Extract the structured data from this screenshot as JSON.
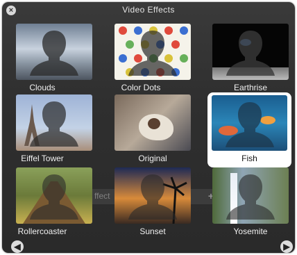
{
  "window": {
    "title": "Video Effects"
  },
  "background": {
    "effect_text": "ffect",
    "plus": "+"
  },
  "effects": [
    {
      "label": "Clouds",
      "selected": false
    },
    {
      "label": "Color Dots",
      "selected": false
    },
    {
      "label": "Earthrise",
      "selected": false
    },
    {
      "label": "Eiffel Tower",
      "selected": false
    },
    {
      "label": "Original",
      "selected": false
    },
    {
      "label": "Fish",
      "selected": true
    },
    {
      "label": "Rollercoaster",
      "selected": false
    },
    {
      "label": "Sunset",
      "selected": false
    },
    {
      "label": "Yosemite",
      "selected": false
    }
  ],
  "nav": {
    "prev_icon": "arrow-left-icon",
    "next_icon": "arrow-right-icon"
  },
  "colors": {
    "panel": "#2f2f2f",
    "selected_bg": "#ffffff",
    "label": "#f0f0f0"
  }
}
